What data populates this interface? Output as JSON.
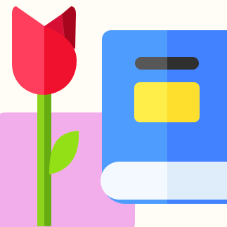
{
  "colors": {
    "background": "#fffdf5",
    "backdrop_pink": "#f2aeea",
    "book_cover_left": "#4f9cff",
    "book_cover_right": "#4281ff",
    "book_pages_left": "#f4f9ff",
    "book_pages_right": "#deedf9",
    "label_left": "#ffee4a",
    "label_right": "#ffdf2e",
    "bar_left": "#575757",
    "bar_right": "#2f2f2f",
    "petal_left": "#ff3d5c",
    "petal_right": "#f0112e",
    "petal_back_left": "#d80f34",
    "petal_back_right": "#a8061f",
    "stem_left": "#8fd41c",
    "stem_right": "#66ad12",
    "leaf": "#94e016"
  },
  "icons": [
    "tulip-icon",
    "book-icon"
  ]
}
